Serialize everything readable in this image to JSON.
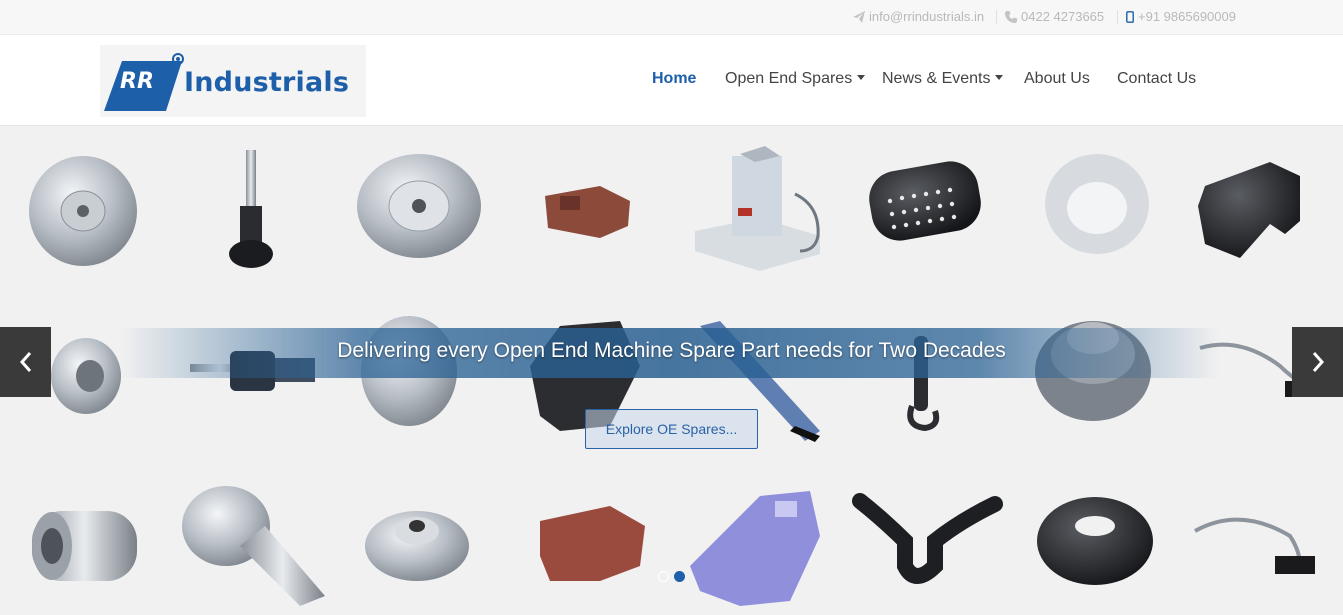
{
  "topbar": {
    "email": "info@rrindustrials.in",
    "phone": "0422 4273665",
    "mobile": "+91 9865690009"
  },
  "logo": {
    "badge_text": "RR",
    "name": "Industrials"
  },
  "nav": {
    "items": [
      {
        "label": "Home",
        "active": true,
        "dropdown": false
      },
      {
        "label": "Open End Spares",
        "active": false,
        "dropdown": true
      },
      {
        "label": "News & Events",
        "active": false,
        "dropdown": true
      },
      {
        "label": "About Us",
        "active": false,
        "dropdown": false
      },
      {
        "label": "Contact Us",
        "active": false,
        "dropdown": false
      }
    ]
  },
  "hero": {
    "headline": "Delivering every Open End Machine Spare Part needs for Two Decades",
    "cta_label": "Explore OE Spares...",
    "slides_total": 2,
    "active_slide": 2
  },
  "colors": {
    "brand_blue": "#1d5fa9",
    "text_gray": "#444444",
    "topbar_text": "#b9b9b9"
  },
  "icons": {
    "email": "paper-plane-icon",
    "phone": "phone-icon",
    "mobile": "mobile-icon",
    "prev": "chevron-left-icon",
    "next": "chevron-right-icon"
  }
}
